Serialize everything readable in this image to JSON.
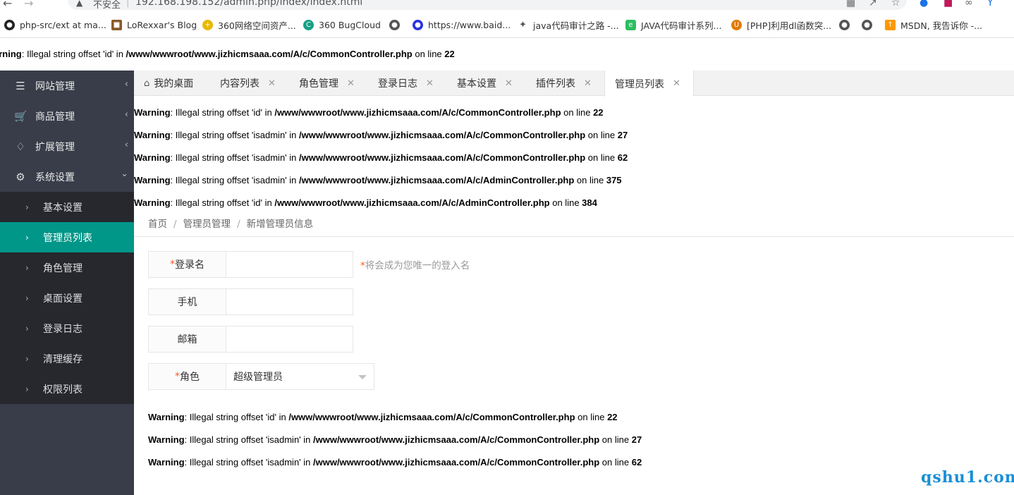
{
  "browser": {
    "insecure_label": "不安全",
    "url": "192.168.198.152/admin.php/index/index.html",
    "bookmarks": [
      {
        "label": "php-src/ext at ma...",
        "icon": "github-icon",
        "color": "#222222"
      },
      {
        "label": "LoRexxar's Blog",
        "icon": "blog-icon",
        "color": "#8a5a2b"
      },
      {
        "label": "360网络空间资产...",
        "icon": "360-icon",
        "color": "#e8b800"
      },
      {
        "label": "360 BugCloud",
        "icon": "bugcloud-icon",
        "color": "#16a085"
      },
      {
        "label": "",
        "icon": "globe-icon",
        "color": "#555555"
      },
      {
        "label": "https://www.baid...",
        "icon": "baidu-icon",
        "color": "#2932e1"
      },
      {
        "label": "java代码审计之路 -...",
        "icon": "feather-icon",
        "color": "#555555"
      },
      {
        "label": "JAVA代码审计系列...",
        "icon": "evernote-icon",
        "color": "#2dbe60"
      },
      {
        "label": "[PHP]利用dl函数突...",
        "icon": "u-icon",
        "color": "#e07b00"
      },
      {
        "label": "",
        "icon": "globe-icon",
        "color": "#555555"
      },
      {
        "label": "",
        "icon": "globe-icon",
        "color": "#555555"
      },
      {
        "label": "MSDN, 我告诉你 -...",
        "icon": "msdn-icon",
        "color": "#ff9800"
      }
    ]
  },
  "top_warning": {
    "label": "arning",
    "text": ": Illegal string offset 'id' in ",
    "path": "/www/wwwroot/www.jizhicmsaaa.com/A/c/CommonController.php",
    "online": " on line ",
    "line": "22"
  },
  "sidebar": {
    "menus": [
      {
        "label": "网站管理",
        "icon": "list-icon"
      },
      {
        "label": "商品管理",
        "icon": "cart-icon"
      },
      {
        "label": "扩展管理",
        "icon": "extension-icon"
      },
      {
        "label": "系统设置",
        "icon": "gear-icon"
      }
    ],
    "sub_items": [
      {
        "label": "基本设置"
      },
      {
        "label": "管理员列表"
      },
      {
        "label": "角色管理"
      },
      {
        "label": "桌面设置"
      },
      {
        "label": "登录日志"
      },
      {
        "label": "清理缓存"
      },
      {
        "label": "权限列表"
      }
    ]
  },
  "tabs": [
    {
      "label": "我的桌面"
    },
    {
      "label": "内容列表"
    },
    {
      "label": "角色管理"
    },
    {
      "label": "登录日志"
    },
    {
      "label": "基本设置"
    },
    {
      "label": "插件列表"
    },
    {
      "label": "管理员列表"
    }
  ],
  "warnings_top": [
    {
      "label": "Warning",
      "text": ": Illegal string offset 'id' in ",
      "path": "/www/wwwroot/www.jizhicmsaaa.com/A/c/CommonController.php",
      "online": " on line ",
      "line": "22"
    },
    {
      "label": "Warning",
      "text": ": Illegal string offset 'isadmin' in ",
      "path": "/www/wwwroot/www.jizhicmsaaa.com/A/c/CommonController.php",
      "online": " on line ",
      "line": "27"
    },
    {
      "label": "Warning",
      "text": ": Illegal string offset 'isadmin' in ",
      "path": "/www/wwwroot/www.jizhicmsaaa.com/A/c/CommonController.php",
      "online": " on line ",
      "line": "62"
    },
    {
      "label": "Warning",
      "text": ": Illegal string offset 'isadmin' in ",
      "path": "/www/wwwroot/www.jizhicmsaaa.com/A/c/AdminController.php",
      "online": " on line ",
      "line": "375"
    },
    {
      "label": "Warning",
      "text": ": Illegal string offset 'id' in ",
      "path": "/www/wwwroot/www.jizhicmsaaa.com/A/c/AdminController.php",
      "online": " on line ",
      "line": "384"
    }
  ],
  "breadcrumb": {
    "home": "首页",
    "section": "管理员管理",
    "current": "新增管理员信息",
    "separator": "/"
  },
  "form": {
    "username": {
      "label": "登录名",
      "required": "*",
      "value": "",
      "hint_mark": "*",
      "hint": "将会成为您唯一的登入名"
    },
    "phone": {
      "label": "手机",
      "value": ""
    },
    "email": {
      "label": "邮箱",
      "value": ""
    },
    "role": {
      "label": "角色",
      "required": "*",
      "selected": "超级管理员"
    }
  },
  "warnings_bottom": [
    {
      "label": "Warning",
      "text": ": Illegal string offset 'id' in ",
      "path": "/www/wwwroot/www.jizhicmsaaa.com/A/c/CommonController.php",
      "online": " on line ",
      "line": "22"
    },
    {
      "label": "Warning",
      "text": ": Illegal string offset 'isadmin' in ",
      "path": "/www/wwwroot/www.jizhicmsaaa.com/A/c/CommonController.php",
      "online": " on line ",
      "line": "27"
    },
    {
      "label": "Warning",
      "text": ": Illegal string offset 'isadmin' in ",
      "path": "/www/wwwroot/www.jizhicmsaaa.com/A/c/CommonController.php",
      "online": " on line ",
      "line": "62"
    }
  ],
  "watermark": "qshu1.com",
  "colors": {
    "sidebar_bg": "#393d49",
    "submenu_bg": "#26282e",
    "active": "#009688",
    "required": "#ff5722"
  }
}
